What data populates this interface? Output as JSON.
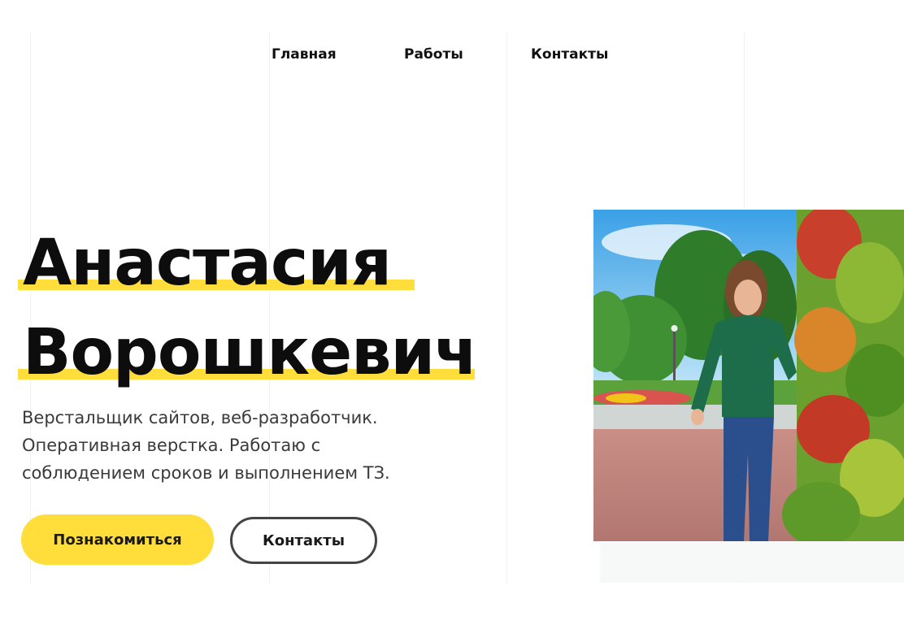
{
  "nav": {
    "home": "Главная",
    "works": "Работы",
    "contacts": "Контакты"
  },
  "hero": {
    "first_name": "Анастасия",
    "last_name": "Ворошкевич",
    "description_lines": [
      "Верстальщик сайтов, веб-разработчик.",
      "Оперативная верстка. Работаю с",
      "соблюдением сроков и выполнением ТЗ."
    ],
    "primary_button": "Познакомиться",
    "secondary_button": "Контакты"
  },
  "colors": {
    "accent": "#ffde3b",
    "text": "#111111",
    "muted_text": "#3a3a3a",
    "outline": "#444444"
  }
}
